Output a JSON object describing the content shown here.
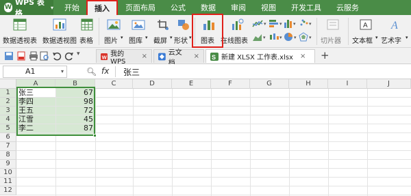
{
  "app": {
    "name": "WPS 表格",
    "logo_glyph": "W"
  },
  "menu": {
    "tabs": [
      {
        "label": "开始"
      },
      {
        "label": "插入"
      },
      {
        "label": "页面布局"
      },
      {
        "label": "公式"
      },
      {
        "label": "数据"
      },
      {
        "label": "审阅"
      },
      {
        "label": "视图"
      },
      {
        "label": "开发工具"
      },
      {
        "label": "云服务"
      }
    ],
    "active_tab": "插入",
    "highlight_color": "#e0201a",
    "bar_color": "#4a8c47"
  },
  "ribbon": {
    "pivot_table": "数据透视表",
    "pivot_chart": "数据透视图",
    "table": "表格",
    "picture": "图片",
    "gallery": "图库",
    "screenshot": "截屏",
    "shapes": "形状",
    "chart": "图表",
    "online_chart": "在线图表",
    "slicer": "切片器",
    "textbox": "文本框",
    "wordart": "艺术字"
  },
  "doc_tabs": [
    {
      "label": "我的WPS"
    },
    {
      "label": "云文档"
    },
    {
      "label": "新建 XLSX 工作表.xlsx"
    }
  ],
  "new_tab_symbol": "+",
  "formula_bar": {
    "name_box": "A1",
    "fx": "fx",
    "content": "张三"
  },
  "grid": {
    "columns": [
      "A",
      "B",
      "C",
      "D",
      "E",
      "F",
      "G",
      "H",
      "I",
      "J"
    ],
    "rows": [
      "1",
      "2",
      "3",
      "4",
      "5",
      "6",
      "7",
      "8",
      "9",
      "10",
      "11",
      "12"
    ],
    "data": [
      {
        "name": "张三",
        "value": "67"
      },
      {
        "name": "李四",
        "value": "98"
      },
      {
        "name": "王五",
        "value": "72"
      },
      {
        "name": "江雪",
        "value": "45"
      },
      {
        "name": "李二",
        "value": "87"
      }
    ],
    "selection_color": "#3e8f3b"
  }
}
